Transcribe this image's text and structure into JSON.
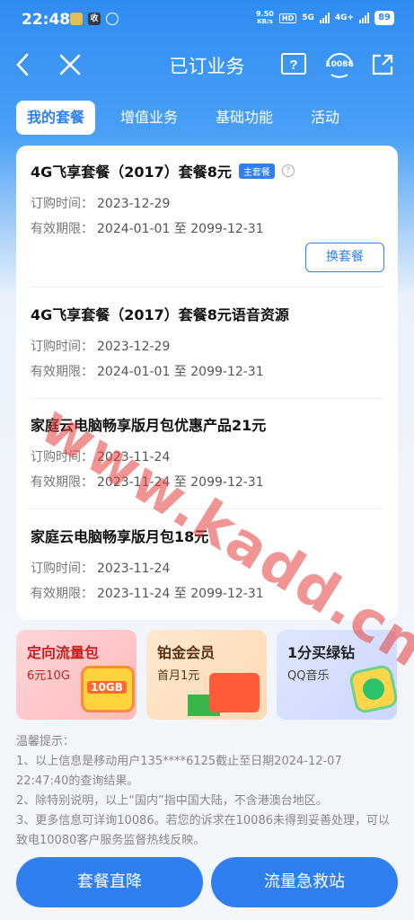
{
  "status_bar": {
    "time": "22:48",
    "speed_top": "9.50",
    "speed_unit": "KB/s",
    "hd": "HD",
    "net1": "5G",
    "net2": "4G+",
    "battery": "89"
  },
  "header": {
    "title": "已订业务",
    "phone_label": "10086"
  },
  "tabs": [
    {
      "label": "我的套餐",
      "active": true
    },
    {
      "label": "增值业务",
      "active": false
    },
    {
      "label": "基础功能",
      "active": false
    },
    {
      "label": "活动",
      "active": false
    }
  ],
  "packages": [
    {
      "name": "4G飞享套餐（2017）套餐8元",
      "tag": "主套餐",
      "order_label": "订购时间：",
      "order_date": "2023-12-29",
      "valid_label": "有效期限：",
      "valid_range": "2024-01-01 至 2099-12-31",
      "action": "换套餐"
    },
    {
      "name": "4G飞享套餐（2017）套餐8元语音资源",
      "order_label": "订购时间：",
      "order_date": "2023-12-29",
      "valid_label": "有效期限：",
      "valid_range": "2024-01-01 至 2099-12-31"
    },
    {
      "name": "家庭云电脑畅享版月包优惠产品21元",
      "order_label": "订购时间：",
      "order_date": "2023-11-24",
      "valid_label": "有效期限：",
      "valid_range": "2023-11-24 至 2099-12-31"
    },
    {
      "name": "家庭云电脑畅享版月包18元",
      "order_label": "订购时间：",
      "order_date": "2023-11-24",
      "valid_label": "有效期限：",
      "valid_range": "2023-11-24 至 2099-12-31"
    }
  ],
  "promos": [
    {
      "title": "定向流量包",
      "subtitle": "6元10G",
      "badge": "10GB"
    },
    {
      "title": "铂金会员",
      "subtitle": "首月1元"
    },
    {
      "title": "1分买绿钻",
      "subtitle": "QQ音乐"
    }
  ],
  "notes": {
    "heading": "温馨提示：",
    "line1": "1、以上信息是移动用户135****6125截止至日期2024-12-07 22:47:40的查询结果。",
    "line2": "2、除特别说明，以上“国内”指中国大陆，不含港澳台地区。",
    "line3": "3、更多信息可详询10086。若您的诉求在10086未得到妥善处理，可以致电10080客户服务监督热线反映。"
  },
  "bottom": {
    "left": "套餐直降",
    "right": "流量急救站"
  },
  "watermark": "www.kadd.cn",
  "colors": {
    "primary": "#2f7ff0",
    "header_bg": "#2f8cf2"
  }
}
